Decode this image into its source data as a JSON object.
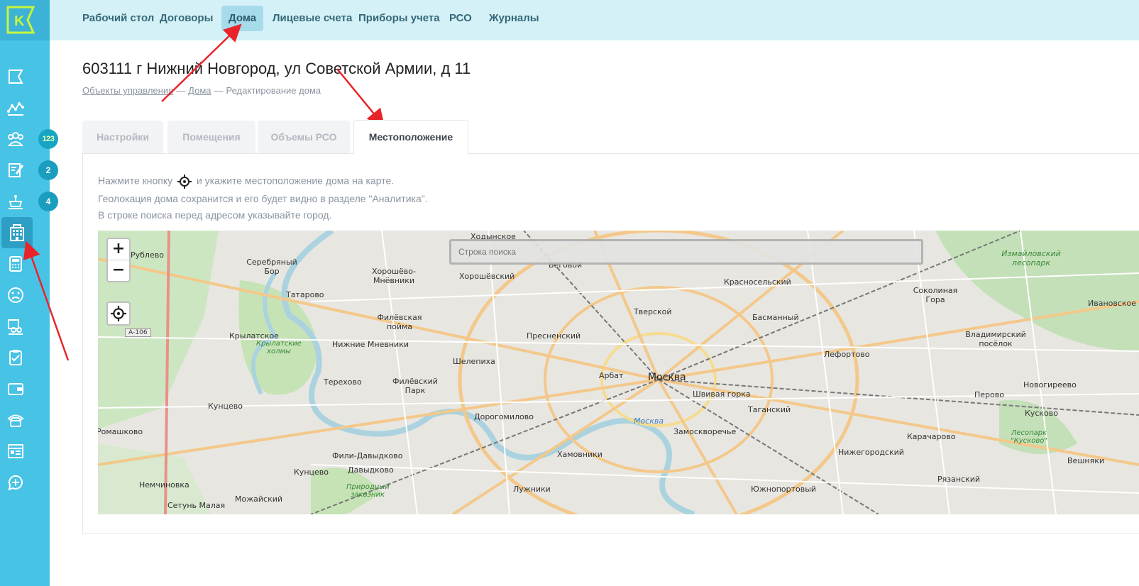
{
  "logo_letter": "K",
  "sidebar": {
    "items": [
      {
        "icon": "flag-icon"
      },
      {
        "icon": "analytics-icon"
      },
      {
        "icon": "people-icon",
        "badge": "123"
      },
      {
        "icon": "document-edit-icon",
        "badge": "2"
      },
      {
        "icon": "meter-icon",
        "badge": "4"
      },
      {
        "icon": "building-icon",
        "active": true
      },
      {
        "icon": "calculator-icon"
      },
      {
        "icon": "sad-face-icon"
      },
      {
        "icon": "staff-icon"
      },
      {
        "icon": "clipboard-check-icon"
      },
      {
        "icon": "wallet-icon"
      },
      {
        "icon": "phone-icon"
      },
      {
        "icon": "form-icon"
      },
      {
        "icon": "chat-plus-icon"
      }
    ]
  },
  "topnav": {
    "items": [
      "Рабочий стол",
      "Договоры",
      "Дома",
      "Лицевые счета",
      "Приборы учета",
      "РСО",
      "Журналы"
    ],
    "active": "Дома"
  },
  "page": {
    "title": "603111 г Нижний Новгород, ул Советской Армии, д 11",
    "breadcrumb": [
      "Объекты управления",
      "Дома",
      "Редактирование дома"
    ],
    "breadcrumb_sep": "—"
  },
  "tabs": [
    "Настройки",
    "Помещения",
    "Объемы РСО",
    "Местоположение"
  ],
  "active_tab": "Местоположение",
  "hint": {
    "line1_before": "Нажмите кнопку",
    "line1_after": "и укажите местоположение дома на карте.",
    "line2": "Геолокация дома сохранится и его будет видно в разделе \"Аналитика\".",
    "line3": "В строке поиска перед адресом указывайте город."
  },
  "map": {
    "zoom_in": "+",
    "zoom_out": "−",
    "search_placeholder": "Строка поиска",
    "labels": {
      "moskva": "Москва",
      "rublevo": "Рублево",
      "serebryany_bor": "Серебряный Бор",
      "khoroshevo": "Хорошёво-Мнёвники",
      "khodynskoe": "Ходынское",
      "khoroshevsky": "Хорошёвский",
      "begovoy": "Беговой",
      "tatarovo": "Татарово",
      "krasnoselsky": "Красносельский",
      "sokolinaya": "Соколиная Гора",
      "izmaylovsky": "Измайловский лесопарк",
      "ivanovskoe": "Ивановское",
      "tverskoy": "Тверской",
      "basmanny": "Басманный",
      "filevskaya": "Филёвская пойма",
      "krylatskoe": "Крылатское",
      "krylatskie": "Крылатские холмы",
      "presnensky": "Пресненский",
      "lefortovo": "Лефортово",
      "vladimirsky": "Владимирский посёлок",
      "nizhnie": "Нижние Мневники",
      "shelepikha": "Шелепиха",
      "arbat": "Арбат",
      "novogireevo": "Новогиреево",
      "terekhovo": "Терехово",
      "filevsky_park": "Филёвский Парк",
      "shvivaya": "Швивая горка",
      "perovo": "Перово",
      "taganskiy": "Таганский",
      "kuncevo": "Кунцево",
      "dorogomilovo": "Дорогомилово",
      "moskva_river": "Москва",
      "kuskovo": "Кусково",
      "romashkovo": "Ромашково",
      "zamoskvorechye": "Замоскворечье",
      "karacharovo": "Карачарово",
      "lesopark_kuskovo": "Лесопарк \"Кусково\"",
      "fili": "Фили-Давыдково",
      "khamovniki": "Хамовники",
      "nizhegorodsky": "Нижегородский",
      "kuncevo2": "Кунцево",
      "davydkovo": "Давыдково",
      "veshnyaki": "Вешняки",
      "nemchinovka": "Немчиновка",
      "ryazansky": "Рязанский",
      "luzhniki": "Лужники",
      "yuzhnoportovy": "Южнопортовый",
      "prirodny": "Природный заказник",
      "mozhaysky": "Можайский",
      "setun": "Сетунь Малая",
      "a106": "А-106"
    }
  },
  "colors": {
    "sidebar": "#47c3e6",
    "topbar": "#d4f1f8",
    "annotation_arrow": "#e8242a"
  }
}
